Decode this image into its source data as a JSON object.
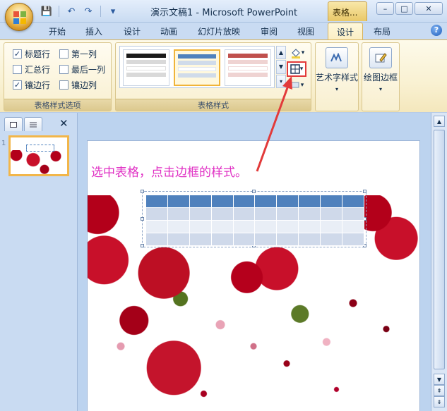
{
  "window": {
    "title": "演示文稿1 - Microsoft PowerPoint",
    "context_tab": "表格...",
    "controls": {
      "minimize": "–",
      "maximize": "□",
      "close": "✕"
    }
  },
  "qat": {
    "save": "💾",
    "undo": "↶",
    "redo": "↷",
    "customize": "▾"
  },
  "tabs": [
    {
      "label": "开始"
    },
    {
      "label": "插入"
    },
    {
      "label": "设计"
    },
    {
      "label": "动画"
    },
    {
      "label": "幻灯片放映"
    },
    {
      "label": "审阅"
    },
    {
      "label": "视图"
    },
    {
      "label": "设计"
    },
    {
      "label": "布局"
    }
  ],
  "active_tab_index": 7,
  "help": "?",
  "ribbon": {
    "style_options": {
      "group_label": "表格样式选项",
      "checkboxes": [
        {
          "label": "标题行",
          "checked": true
        },
        {
          "label": "第一列",
          "checked": false
        },
        {
          "label": "汇总行",
          "checked": false
        },
        {
          "label": "最后一列",
          "checked": false
        },
        {
          "label": "镶边行",
          "checked": true
        },
        {
          "label": "镶边列",
          "checked": false
        }
      ]
    },
    "table_styles": {
      "group_label": "表格样式",
      "styles": [
        {
          "header_color": "#1a1a1a",
          "band_color": "#d9d9d9"
        },
        {
          "header_color": "#4f81bd",
          "band_color": "#d0dbea"
        },
        {
          "header_color": "#c0504d",
          "band_color": "#efd3d2"
        }
      ],
      "selected_index": 1
    },
    "wordart": {
      "label": "艺术字样式"
    },
    "draw_borders": {
      "label": "绘图边框"
    }
  },
  "slides_pane": {
    "slide_number": "1",
    "close": "✕"
  },
  "slide": {
    "caption": "选中表格，点击边框的样式。",
    "table": {
      "rows": 4,
      "cols": 10,
      "header_color": "#4f81bd"
    }
  },
  "colors": {
    "annotation_red": "#e23a3a",
    "caption_magenta": "#e030c4"
  }
}
